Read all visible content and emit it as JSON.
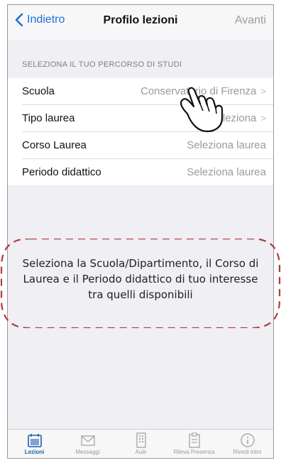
{
  "navbar": {
    "back_label": "Indietro",
    "title": "Profilo lezioni",
    "forward_label": "Avanti"
  },
  "section_header": "SELEZIONA IL TUO PERCORSO DI STUDI",
  "rows": [
    {
      "label": "Scuola",
      "value": "Conservatorio di Firenza"
    },
    {
      "label": "Tipo laurea",
      "value": "Seleziona"
    },
    {
      "label": "Corso Laurea",
      "value": "Seleziona laurea"
    },
    {
      "label": "Periodo didattico",
      "value": "Seleziona laurea"
    }
  ],
  "callout": {
    "text": "Seleziona la Scuola/Dipartimento, il Corso di Laurea e il Periodo didattico di tuo interesse tra quelli disponibili"
  },
  "tabbar": {
    "items": [
      {
        "label": "Lezioni",
        "icon": "calendar-icon"
      },
      {
        "label": "Messaggi",
        "icon": "envelope-icon"
      },
      {
        "label": "Aule",
        "icon": "building-icon"
      },
      {
        "label": "Rileva Presenza",
        "icon": "clipboard-icon"
      },
      {
        "label": "Rivedi intro",
        "icon": "info-icon"
      }
    ]
  },
  "colors": {
    "accent": "#1d6fdc",
    "active_tab": "#1d5fb4",
    "callout_border": "#b03a3a"
  }
}
